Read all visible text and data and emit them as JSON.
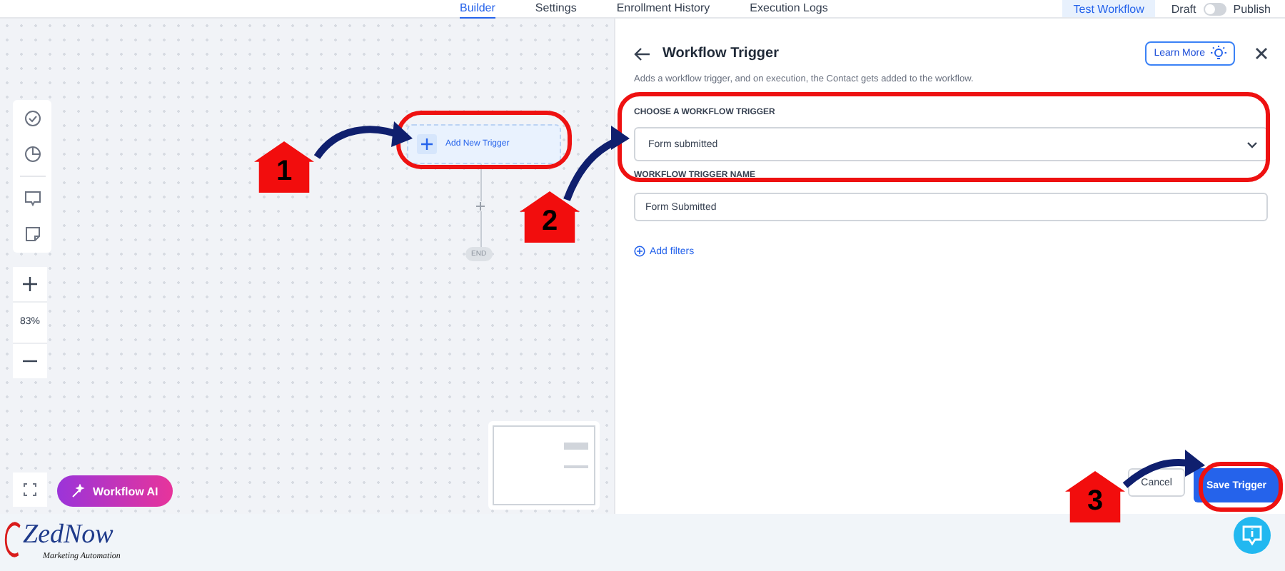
{
  "top_nav": {
    "tabs": [
      {
        "label": "Builder",
        "selected": true
      },
      {
        "label": "Settings",
        "selected": false
      },
      {
        "label": "Enrollment History",
        "selected": false
      },
      {
        "label": "Execution Logs",
        "selected": false
      }
    ],
    "test_button": "Test Workflow",
    "toggle": {
      "off_label": "Draft",
      "on_label": "Publish",
      "on": false
    }
  },
  "canvas": {
    "trigger_node": "Add New Trigger",
    "end_node": "END",
    "zoom": "83%",
    "ai_button": "Workflow AI"
  },
  "panel": {
    "title": "Workflow Trigger",
    "description": "Adds a workflow trigger, and on execution, the Contact gets added to the workflow.",
    "learn_more": "Learn More",
    "trigger_label": "CHOOSE A WORKFLOW TRIGGER",
    "trigger_value": "Form submitted",
    "name_label": "WORKFLOW TRIGGER NAME",
    "name_value": "Form Submitted",
    "add_filters": "Add filters",
    "cancel": "Cancel",
    "save": "Save Trigger"
  },
  "annotations": [
    {
      "number": "1"
    },
    {
      "number": "2"
    },
    {
      "number": "3"
    }
  ],
  "logo": {
    "name": "ZedNow",
    "tagline": "Marketing Automation"
  }
}
